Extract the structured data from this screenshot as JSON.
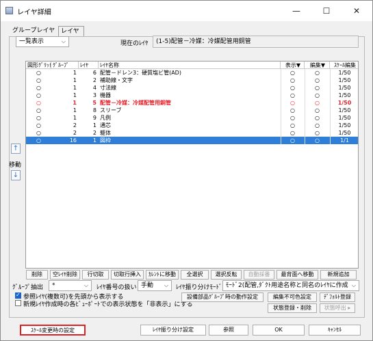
{
  "window": {
    "title": "レイヤ詳細",
    "min": "—",
    "max": "☐",
    "close": "✕"
  },
  "tabs": [
    {
      "label": "グループレイヤ",
      "active": false
    },
    {
      "label": "レイヤ",
      "active": true
    }
  ],
  "view_select": {
    "value": "一覧表示"
  },
  "current_layer": {
    "label": "現在のﾚｲﾔ",
    "value": "(1-5)配管－冷媒：冷媒配管用銅管"
  },
  "grid": {
    "columns": [
      "図形ｸﾞﾘｯﾄﾞ",
      "ｸﾞﾙｰﾌﾟ",
      "ﾚｲﾔ",
      "ﾚｲﾔ名称",
      "表示▼",
      "編集▼",
      "ｽｹｰﾙ編集"
    ],
    "rows": [
      {
        "grid": "○",
        "group": "1",
        "layer": "6",
        "name": "配管－ドレン3：硬質塩ビ管(AD)",
        "show": "○",
        "edit": "○",
        "scale": "1/50",
        "state": "normal"
      },
      {
        "grid": "○",
        "group": "1",
        "layer": "2",
        "name": "補助線・文字",
        "show": "○",
        "edit": "○",
        "scale": "1/50",
        "state": "normal"
      },
      {
        "grid": "○",
        "group": "1",
        "layer": "4",
        "name": "寸法線",
        "show": "○",
        "edit": "○",
        "scale": "1/50",
        "state": "normal"
      },
      {
        "grid": "○",
        "group": "1",
        "layer": "3",
        "name": "機器",
        "show": "○",
        "edit": "○",
        "scale": "1/50",
        "state": "normal"
      },
      {
        "grid": "○",
        "group": "1",
        "layer": "5",
        "name": "配管－冷媒：冷媒配管用銅管",
        "show": "○",
        "edit": "○",
        "scale": "1/50",
        "state": "current"
      },
      {
        "grid": "○",
        "group": "1",
        "layer": "8",
        "name": "スリーブ",
        "show": "○",
        "edit": "○",
        "scale": "1/50",
        "state": "normal"
      },
      {
        "grid": "○",
        "group": "1",
        "layer": "9",
        "name": "凡例",
        "show": "○",
        "edit": "○",
        "scale": "1/50",
        "state": "normal"
      },
      {
        "grid": "○",
        "group": "2",
        "layer": "1",
        "name": "通芯",
        "show": "○",
        "edit": "○",
        "scale": "1/50",
        "state": "normal"
      },
      {
        "grid": "○",
        "group": "2",
        "layer": "2",
        "name": "躯体",
        "show": "○",
        "edit": "○",
        "scale": "1/50",
        "state": "normal"
      },
      {
        "grid": "○",
        "group": "16",
        "layer": "1",
        "name": "図枠",
        "show": "○",
        "edit": "○",
        "scale": "1/1",
        "state": "selected"
      }
    ]
  },
  "side": {
    "move_label": "移動",
    "up": "↑",
    "down": "↓"
  },
  "buttons_row1": [
    "削除",
    "空ﾚｲﾔ削除",
    "行切取",
    "切取行挿入",
    "ｶﾚﾝﾄに移動",
    "全選択",
    "選択反転",
    "自動採番",
    "最背面へ移動",
    "新規追加"
  ],
  "row2": {
    "group_extract_label": "ｸﾞﾙｰﾌﾟ抽出",
    "group_extract_value": "*",
    "layer_number_label": "ﾚｲﾔ番号の扱い",
    "layer_number_value": "手動",
    "split_mode_label": "ﾚｲﾔ振り分けﾓｰﾄﾞ",
    "split_mode_value": "ﾓｰﾄﾞ2(配管,ﾀﾞｸﾄ用途名称と同名のﾚｲﾔに作成"
  },
  "checks": [
    {
      "label": "参照ﾚｲﾔ(複数可)を先頭から表示する",
      "checked": true
    },
    {
      "label": "新規ﾚｲﾔ作成時の各ﾋﾞｭｰﾎﾟｰﾄでの表示状態を「非表示」にする",
      "checked": false
    }
  ],
  "right_buttons": {
    "equipment_group": "設備部品ｸﾞﾙｰﾌﾟ時の動作設定",
    "no_edit_color": "編集不可色設定",
    "default_reg": "ﾃﾞﾌｫﾙﾄ登録",
    "state_reg_delete": "状態登録・削除",
    "state_recall": "状態呼出 ▸"
  },
  "bottom": {
    "scale_change": "ｽｹｰﾙ変更時の設定",
    "layer_split": "ﾚｲﾔ振り分け設定",
    "reference": "参照",
    "ok": "OK",
    "cancel": "ｷｬﾝｾﾙ"
  },
  "colors": {
    "selected": "#2f7fd8",
    "current_text": "#e8202a",
    "highlight_border": "#e02020"
  }
}
